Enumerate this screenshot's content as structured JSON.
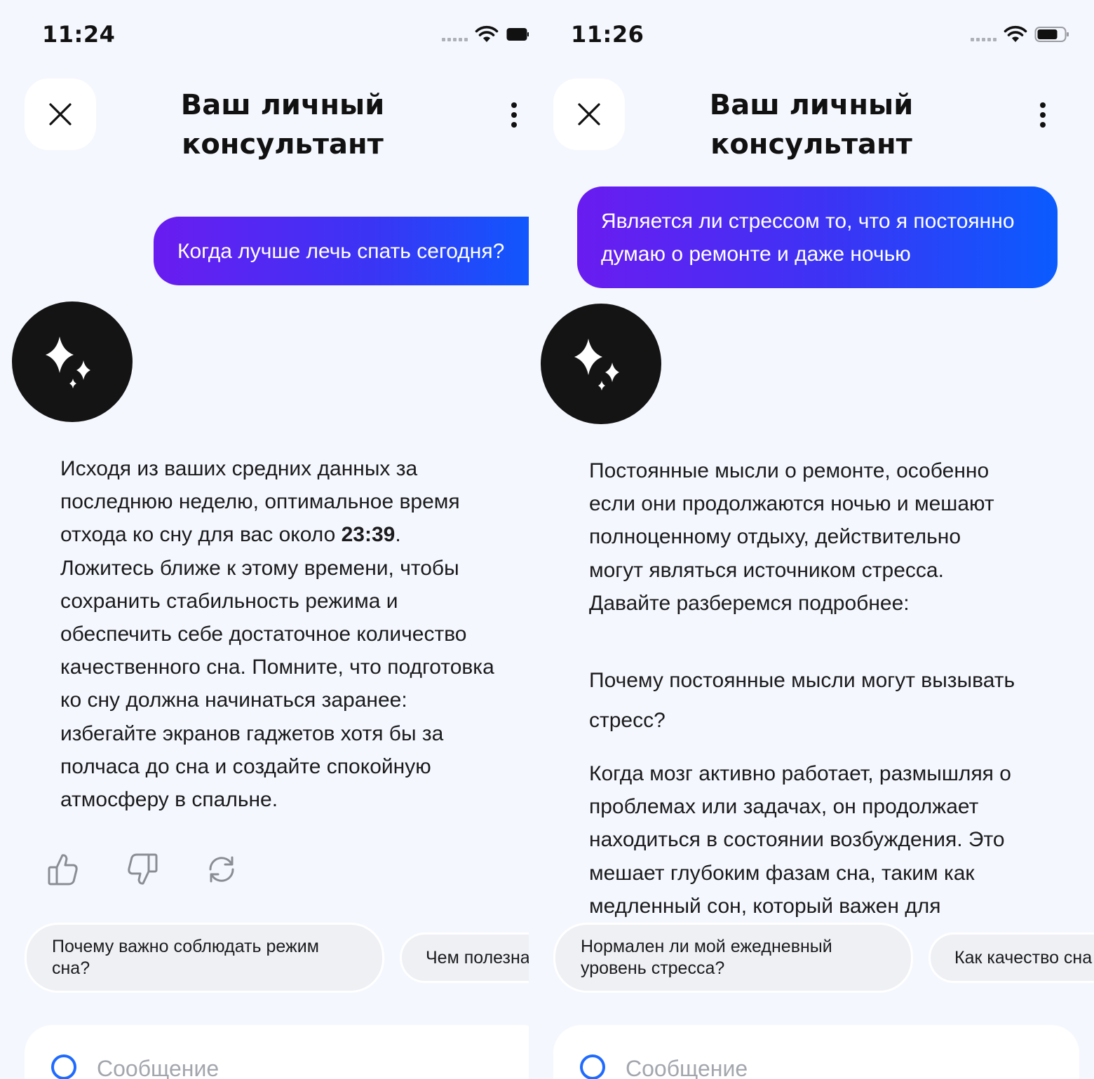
{
  "screens": [
    {
      "status_time": "11:24",
      "title": "Ваш личный консультант",
      "user_message": "Когда лучше лечь спать сегодня?",
      "answer": {
        "part1": "Исходя из ваших средних данных за последнюю неделю, оптимальное время отхода ко сну для вас около ",
        "bold": "23:39",
        "part2": ". Ложитесь ближе к этому времени, чтобы сохранить стабильность режима и обеспечить себе достаточное количество качественного сна. Помните, что подготовка ко сну должна начинаться заранее: избегайте экранов гаджетов хотя бы за полчаса до сна и создайте спокойную атмосферу в спальне."
      },
      "suggestions": [
        "Почему важно соблюдать режим сна?",
        "Чем полезна"
      ],
      "input_placeholder": "Сообщение"
    },
    {
      "status_time": "11:26",
      "title": "Ваш личный консультант",
      "user_message": "Является ли стрессом то, что я постоянно думаю о ремонте и даже ночью",
      "answer": {
        "intro": "Постоянные мысли о ремонте, особенно если они продолжаются ночью и мешают полноценному отдыху, действительно могут являться источником стресса. Давайте разберемся подробнее:",
        "heading": "Почему постоянные мысли могут вызывать стресс?",
        "body": "Когда мозг активно работает, размышляя о проблемах или задачах, он продолжает находиться в состоянии возбуждения. Это мешает глубоким фазам сна, таким как медленный сон, который важен для"
      },
      "suggestions": [
        "Нормален ли мой ежедневный уровень стресса?",
        "Как качество сна"
      ],
      "input_placeholder": "Сообщение"
    }
  ]
}
